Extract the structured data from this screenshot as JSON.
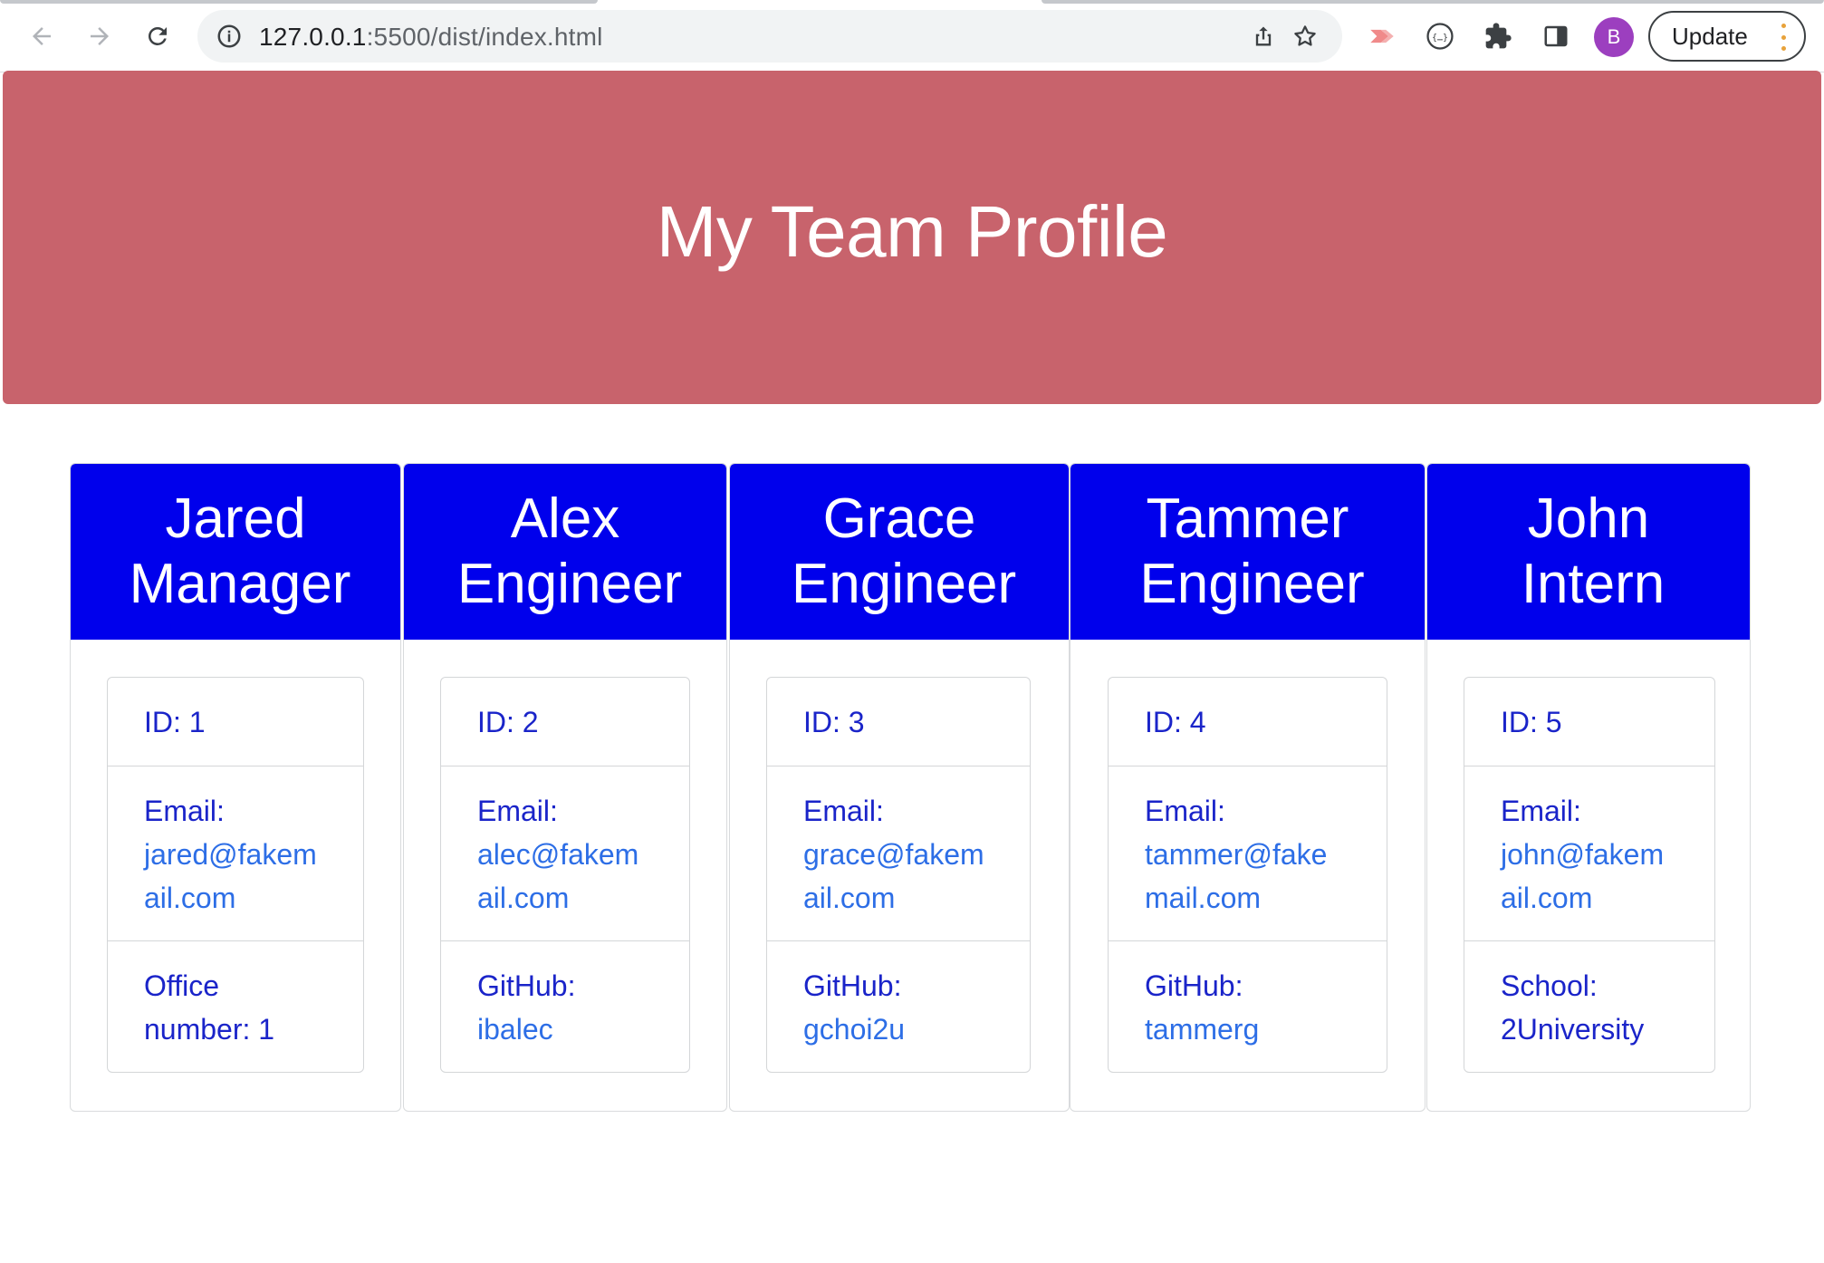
{
  "browser": {
    "url_host": "127.0.0.1",
    "url_rest": ":5500/dist/index.html",
    "profile_initial": "B",
    "update_label": "Update"
  },
  "page": {
    "title": "My Team Profile",
    "colors": {
      "hero_bg": "#c8636c",
      "card_header_bg": "#0000ec",
      "text_blue": "#1a24c9",
      "link_blue": "#2d6ee6"
    }
  },
  "team": [
    {
      "name": "Jared",
      "role": "Manager",
      "id": "ID: 1",
      "email_label": "Email:",
      "email_part1": "jared@fakem",
      "email_part2": "ail.com",
      "extra_label": "Office",
      "extra_value": "number: 1"
    },
    {
      "name": "Alex",
      "role": "Engineer",
      "id": "ID: 2",
      "email_label": "Email:",
      "email_part1": "alec@fakem",
      "email_part2": "ail.com",
      "extra_label": "GitHub:",
      "extra_value": "ibalec"
    },
    {
      "name": "Grace",
      "role": "Engineer",
      "id": "ID: 3",
      "email_label": "Email:",
      "email_part1": "grace@fakem",
      "email_part2": "ail.com",
      "extra_label": "GitHub:",
      "extra_value": "gchoi2u"
    },
    {
      "name": "Tammer",
      "role": "Engineer",
      "id": "ID: 4",
      "email_label": "Email:",
      "email_part1": "tammer@fake",
      "email_part2": "mail.com",
      "extra_label": "GitHub:",
      "extra_value": "tammerg"
    },
    {
      "name": "John",
      "role": "Intern",
      "id": "ID: 5",
      "email_label": "Email:",
      "email_part1": "john@fakem",
      "email_part2": "ail.com",
      "extra_label": "School:",
      "extra_value": "2University"
    }
  ]
}
